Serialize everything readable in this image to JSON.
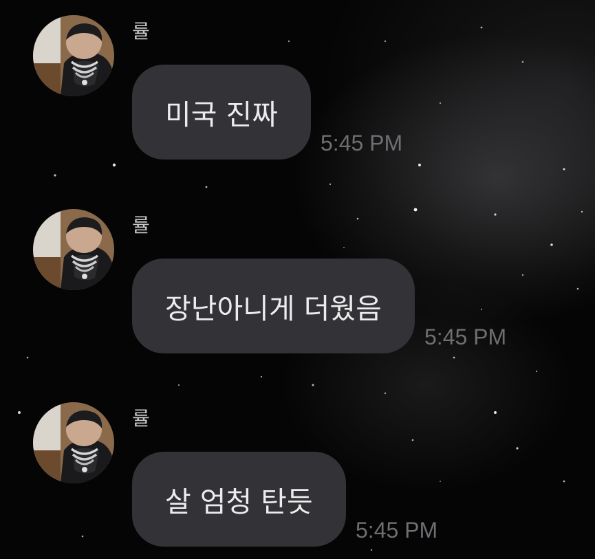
{
  "conversation": {
    "messages": [
      {
        "sender": "률",
        "text": "미국 진짜",
        "time": "5:45 PM",
        "avatar": "profile-photo"
      },
      {
        "sender": "률",
        "text": "장난아니게 더웠음",
        "time": "5:45 PM",
        "avatar": "profile-photo"
      },
      {
        "sender": "률",
        "text": "살 엄청 탄듯",
        "time": "5:45 PM",
        "avatar": "profile-photo"
      }
    ]
  },
  "colors": {
    "background": "#050505",
    "bubble": "#323237",
    "bubble_text": "#ececec",
    "sender_text": "#c9c9c9",
    "time_text": "#6e6e73"
  }
}
